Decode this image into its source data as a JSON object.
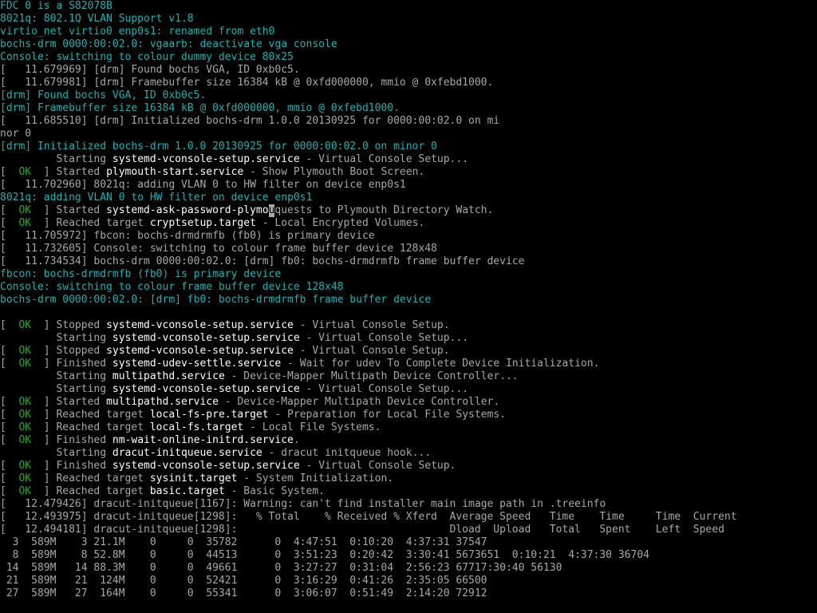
{
  "colors": {
    "background": "#000000",
    "text": "#a8a8a8",
    "kernel_cyan": "#18b2b2",
    "ok_green": "#18b218",
    "highlight": "#ffffff"
  },
  "lines": [
    {
      "kind": "cyan",
      "text": "FDC 0 is a S82078B"
    },
    {
      "kind": "cyan",
      "text": "8021q: 802.1Q VLAN Support v1.8"
    },
    {
      "kind": "cyan",
      "text": "virtio_net virtio0 enp0s1: renamed from eth0"
    },
    {
      "kind": "cyan",
      "text": "bochs-drm 0000:00:02.0: vgaarb: deactivate vga console"
    },
    {
      "kind": "cyan",
      "text": "Console: switching to colour dummy device 80x25"
    },
    {
      "kind": "log",
      "text": "[   11.679969] [drm] Found bochs VGA, ID 0xb0c5."
    },
    {
      "kind": "log",
      "text": "[   11.679981] [drm] Framebuffer size 16384 kB @ 0xfd000000, mmio @ 0xfebd1000."
    },
    {
      "kind": "cyan",
      "text": "[drm] Found bochs VGA, ID 0xb0c5."
    },
    {
      "kind": "cyan",
      "text": "[drm] Framebuffer size 16384 kB @ 0xfd000000, mmio @ 0xfebd1000."
    },
    {
      "kind": "log",
      "text": "[   11.685510] [drm] Initialized bochs-drm 1.0.0 20130925 for 0000:00:02.0 on mi"
    },
    {
      "kind": "log",
      "text": "nor 0"
    },
    {
      "kind": "cyan",
      "text": "[drm] Initialized bochs-drm 1.0.0 20130925 for 0000:00:02.0 on minor 0"
    },
    {
      "kind": "starting",
      "prefix": "         Starting ",
      "unit": "systemd-vconsole-setup.service",
      "desc": " - Virtual Console Setup..."
    },
    {
      "kind": "status",
      "status": "OK",
      "verb": "Started ",
      "unit": "plymouth-start.service",
      "desc": " - Show Plymouth Boot Screen."
    },
    {
      "kind": "log",
      "text": "[   11.702960] 8021q: adding VLAN 0 to HW filter on device enp0s1"
    },
    {
      "kind": "cyan",
      "text": "8021q: adding VLAN 0 to HW filter on device enp0s1"
    },
    {
      "kind": "status_cursor",
      "status": "OK",
      "verb": "Started ",
      "unit": "systemd-ask-password-plymo",
      "cursor": "u",
      "desc": "quests to Plymouth Directory Watch."
    },
    {
      "kind": "status",
      "status": "OK",
      "verb": "Reached target ",
      "unit": "cryptsetup.target",
      "desc": " - Local Encrypted Volumes."
    },
    {
      "kind": "log",
      "text": "[   11.705972] fbcon: bochs-drmdrmfb (fb0) is primary device"
    },
    {
      "kind": "log",
      "text": "[   11.732605] Console: switching to colour frame buffer device 128x48"
    },
    {
      "kind": "log",
      "text": "[   11.734534] bochs-drm 0000:00:02.0: [drm] fb0: bochs-drmdrmfb frame buffer device"
    },
    {
      "kind": "cyan",
      "text": "fbcon: bochs-drmdrmfb (fb0) is primary device"
    },
    {
      "kind": "cyan",
      "text": "Console: switching to colour frame buffer device 128x48"
    },
    {
      "kind": "cyan",
      "text": "bochs-drm 0000:00:02.0: [drm] fb0: bochs-drmdrmfb frame buffer device"
    },
    {
      "kind": "blank",
      "text": ""
    },
    {
      "kind": "status",
      "status": "OK",
      "verb": "Stopped ",
      "unit": "systemd-vconsole-setup.service",
      "desc": " - Virtual Console Setup."
    },
    {
      "kind": "starting",
      "prefix": "         Starting ",
      "unit": "systemd-vconsole-setup.service",
      "desc": " - Virtual Console Setup..."
    },
    {
      "kind": "status",
      "status": "OK",
      "verb": "Stopped ",
      "unit": "systemd-vconsole-setup.service",
      "desc": " - Virtual Console Setup."
    },
    {
      "kind": "status",
      "status": "OK",
      "verb": "Finished ",
      "unit": "systemd-udev-settle.service",
      "desc": " - Wait for udev To Complete Device Initialization."
    },
    {
      "kind": "starting",
      "prefix": "         Starting ",
      "unit": "multipathd.service",
      "desc": " - Device-Mapper Multipath Device Controller..."
    },
    {
      "kind": "starting",
      "prefix": "         Starting ",
      "unit": "systemd-vconsole-setup.service",
      "desc": " - Virtual Console Setup..."
    },
    {
      "kind": "status",
      "status": "OK",
      "verb": "Started ",
      "unit": "multipathd.service",
      "desc": " - Device-Mapper Multipath Device Controller."
    },
    {
      "kind": "status",
      "status": "OK",
      "verb": "Reached target ",
      "unit": "local-fs-pre.target",
      "desc": " - Preparation for Local File Systems."
    },
    {
      "kind": "status",
      "status": "OK",
      "verb": "Reached target ",
      "unit": "local-fs.target",
      "desc": " - Local File Systems."
    },
    {
      "kind": "status",
      "status": "OK",
      "verb": "Finished ",
      "unit": "nm-wait-online-initrd.service",
      "desc": "."
    },
    {
      "kind": "starting",
      "prefix": "         Starting ",
      "unit": "dracut-initqueue.service",
      "desc": " - dracut initqueue hook..."
    },
    {
      "kind": "status",
      "status": "OK",
      "verb": "Finished ",
      "unit": "systemd-vconsole-setup.service",
      "desc": " - Virtual Console Setup."
    },
    {
      "kind": "status",
      "status": "OK",
      "verb": "Reached target ",
      "unit": "sysinit.target",
      "desc": " - System Initialization."
    },
    {
      "kind": "status",
      "status": "OK",
      "verb": "Reached target ",
      "unit": "basic.target",
      "desc": " - Basic System."
    },
    {
      "kind": "log",
      "text": "[   12.479426] dracut-initqueue[1167]: Warning: can't find installer main image path in .treeinfo"
    },
    {
      "kind": "log",
      "text": "[   12.493975] dracut-initqueue[1298]:   % Total    % Received % Xferd  Average Speed   Time    Time     Time  Current"
    },
    {
      "kind": "log",
      "text": "[   12.494181] dracut-initqueue[1298]:                                  Dload  Upload   Total   Spent    Left  Speed"
    },
    {
      "kind": "log",
      "text": "  3  589M    3 21.1M    0     0  35782      0  4:47:51  0:10:20  4:37:31 37547"
    },
    {
      "kind": "log",
      "text": "  8  589M    8 52.8M    0     0  44513      0  3:51:23  0:20:42  3:30:41 5673651  0:10:21  4:37:30 36704"
    },
    {
      "kind": "log",
      "text": " 14  589M   14 88.3M    0     0  49661      0  3:27:27  0:31:04  2:56:23 67717:30:40 56130"
    },
    {
      "kind": "log",
      "text": " 21  589M   21  124M    0     0  52421      0  3:16:29  0:41:26  2:35:05 66500"
    },
    {
      "kind": "log",
      "text": " 27  589M   27  164M    0     0  55341      0  3:06:07  0:51:49  2:14:20 72912"
    }
  ]
}
